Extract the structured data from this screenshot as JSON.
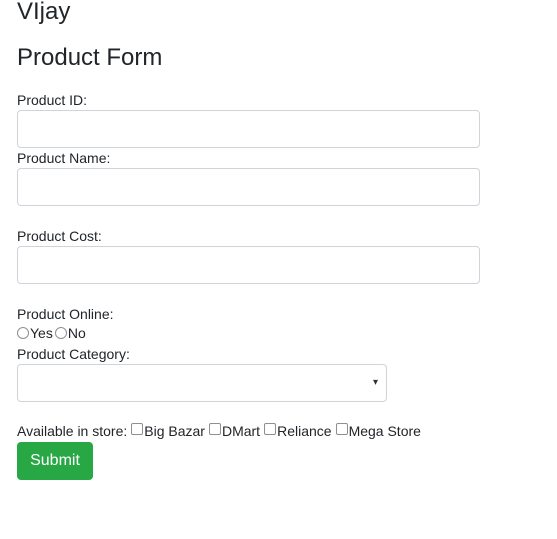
{
  "header": {
    "user_name": "VIjay",
    "form_title": "Product Form"
  },
  "form": {
    "product_id": {
      "label": "Product ID:",
      "value": "",
      "placeholder": ""
    },
    "product_name": {
      "label": "Product Name:",
      "value": "",
      "placeholder": ""
    },
    "product_cost": {
      "label": "Product Cost:",
      "value": "",
      "placeholder": ""
    },
    "product_online": {
      "label": "Product Online:",
      "options": [
        "Yes",
        "No"
      ]
    },
    "product_category": {
      "label": "Product Category:",
      "selected": "",
      "arrow": "▾"
    },
    "available_in_store": {
      "label": "Available in store:",
      "stores": [
        "Big Bazar",
        "DMart",
        "Reliance",
        "Mega Store"
      ]
    },
    "submit_label": "Submit"
  },
  "icons": {
    "select_arrow": "chevron-down-icon"
  },
  "colors": {
    "submit_bg": "#28a745",
    "input_border": "#ced4da"
  }
}
